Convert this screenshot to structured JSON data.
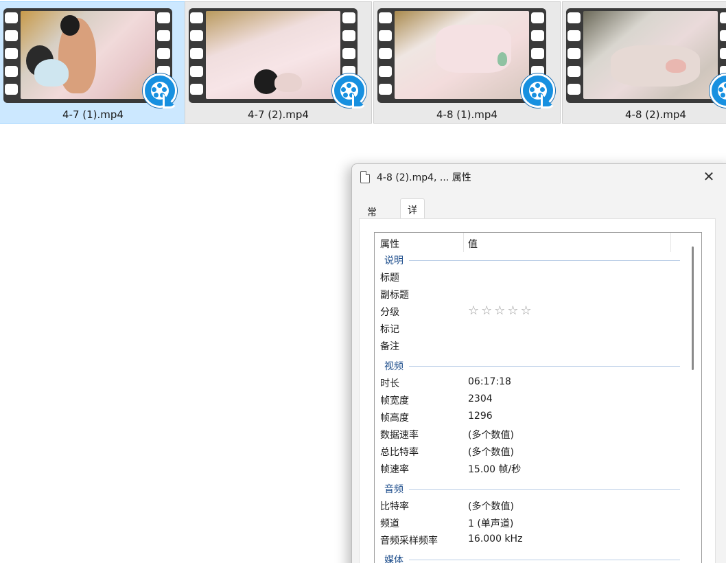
{
  "files": [
    {
      "name": "4-7 (1).mp4",
      "selected": true
    },
    {
      "name": "4-7 (2).mp4",
      "selected": false
    },
    {
      "name": "4-8 (1).mp4",
      "selected": false
    },
    {
      "name": "4-8 (2).mp4",
      "selected": false
    }
  ],
  "dialog": {
    "title": "4-8 (2).mp4, ... 属性",
    "close_glyph": "✕",
    "tabs": {
      "general": "常规",
      "details": "详细信息"
    },
    "columns": {
      "property": "属性",
      "value": "值"
    },
    "sections": {
      "description": "说明",
      "video": "视频",
      "audio": "音频",
      "media": "媒体"
    },
    "description_rows": [
      {
        "key": "标题",
        "value": ""
      },
      {
        "key": "副标题",
        "value": ""
      },
      {
        "key": "分级",
        "value": "",
        "stars": "☆☆☆☆☆",
        "rating": 0
      },
      {
        "key": "标记",
        "value": ""
      },
      {
        "key": "备注",
        "value": ""
      }
    ],
    "video_rows": [
      {
        "key": "时长",
        "value": "06:17:18"
      },
      {
        "key": "帧宽度",
        "value": "2304"
      },
      {
        "key": "帧高度",
        "value": "1296"
      },
      {
        "key": "数据速率",
        "value": "(多个数值)"
      },
      {
        "key": "总比特率",
        "value": "(多个数值)"
      },
      {
        "key": "帧速率",
        "value": "15.00 帧/秒"
      }
    ],
    "audio_rows": [
      {
        "key": "比特率",
        "value": "(多个数值)"
      },
      {
        "key": "频道",
        "value": "1 (单声道)"
      },
      {
        "key": "音频采样频率",
        "value": "16.000 kHz"
      }
    ]
  },
  "colors": {
    "selected_tile": "#cce8ff",
    "tile": "#e9e9e9",
    "section_label": "#1e4e8c",
    "player_icon": "#1790e0"
  }
}
